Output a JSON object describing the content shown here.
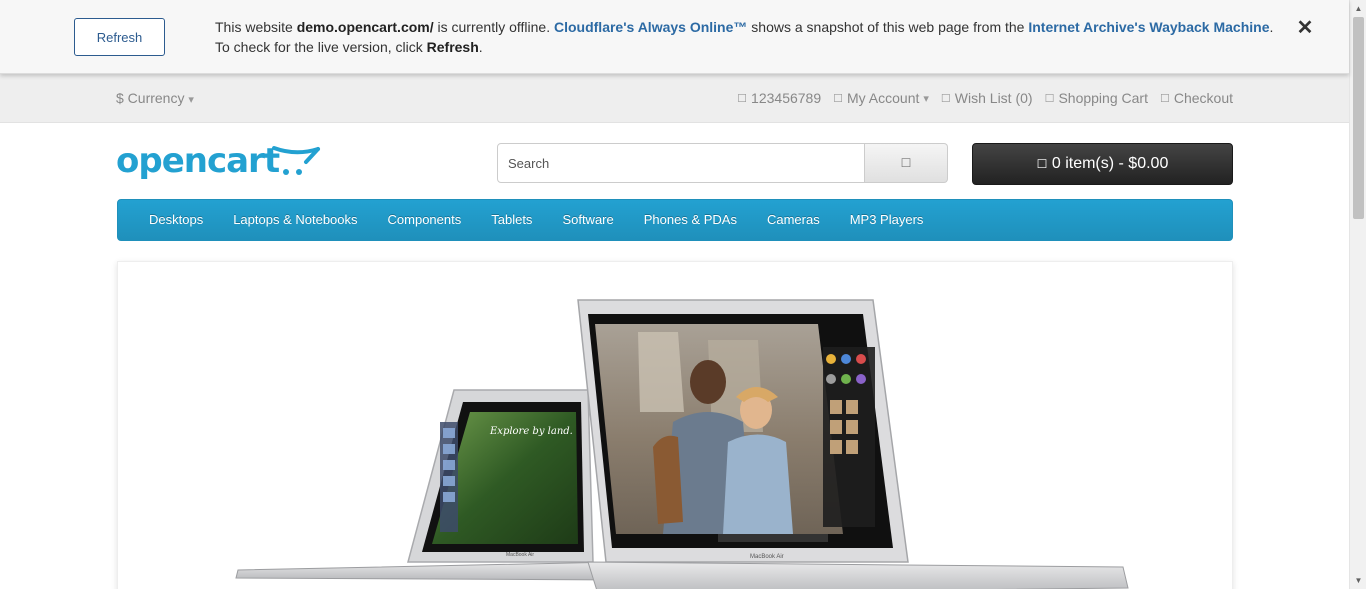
{
  "banner": {
    "refresh_label": "Refresh",
    "msg_prefix": "This website ",
    "site": "demo.opencart.com/",
    "msg_mid1": " is currently offline. ",
    "always_online": "Cloudflare's Always Online™",
    "msg_mid2": " shows a snapshot of this web page from the ",
    "wayback": "Internet Archive's Wayback Machine",
    "msg_mid3": ". To check for the live version, click ",
    "refresh_word": "Refresh",
    "msg_end": ".",
    "close_glyph": "✕"
  },
  "top_bar": {
    "currency": "$ Currency",
    "links": [
      {
        "label": "123456789",
        "icon": "phone-icon"
      },
      {
        "label": "My Account",
        "icon": "user-icon"
      },
      {
        "label": "Wish List (0)",
        "icon": "heart-icon"
      },
      {
        "label": "Shopping Cart",
        "icon": "cart-icon"
      },
      {
        "label": "Checkout",
        "icon": "share-icon"
      }
    ]
  },
  "header": {
    "logo_text": "opencart",
    "search_placeholder": "Search",
    "cart_label": "0 item(s) - $0.00"
  },
  "menu": {
    "items": [
      "Desktops",
      "Laptops & Notebooks",
      "Components",
      "Tablets",
      "Software",
      "Phones & PDAs",
      "Cameras",
      "MP3 Players"
    ]
  },
  "slideshow": {
    "caption_small": "Explore by land.",
    "brand_left": "MacBook Air",
    "brand_right": "MacBook Air"
  },
  "colors": {
    "accent": "#23a1d1",
    "link": "#2c6aa4",
    "cart_bg": "#333333"
  }
}
